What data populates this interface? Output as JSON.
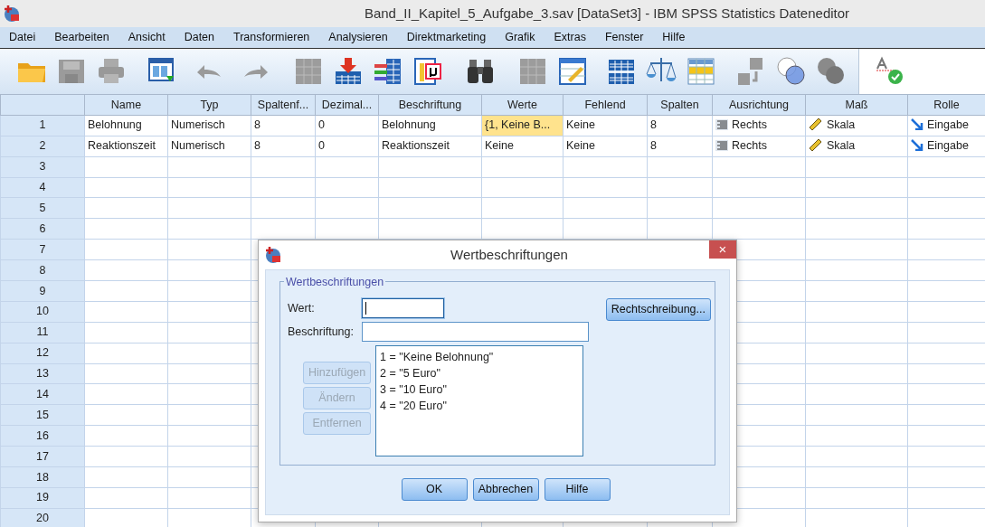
{
  "window": {
    "title": "Band_II_Kapitel_5_Aufgabe_3.sav [DataSet3] - IBM SPSS Statistics Dateneditor"
  },
  "menu": [
    "Datei",
    "Bearbeiten",
    "Ansicht",
    "Daten",
    "Transformieren",
    "Analysieren",
    "Direktmarketing",
    "Grafik",
    "Extras",
    "Fenster",
    "Hilfe"
  ],
  "table": {
    "columns": [
      "Name",
      "Typ",
      "Spaltenf...",
      "Dezimal...",
      "Beschriftung",
      "Werte",
      "Fehlend",
      "Spalten",
      "Ausrichtung",
      "Maß",
      "Rolle"
    ],
    "rows": [
      {
        "number": "1",
        "cells": [
          {
            "kind": "text",
            "text": "Belohnung",
            "selected": false
          },
          {
            "kind": "text",
            "text": "Numerisch",
            "selected": false
          },
          {
            "kind": "text",
            "text": "8",
            "selected": false
          },
          {
            "kind": "text",
            "text": "0",
            "selected": false
          },
          {
            "kind": "text",
            "text": "Belohnung",
            "selected": false
          },
          {
            "kind": "text",
            "text": "{1, Keine B...",
            "selected": true
          },
          {
            "kind": "text",
            "text": "Keine",
            "selected": false
          },
          {
            "kind": "text",
            "text": "8",
            "selected": false
          },
          {
            "kind": "align",
            "text": "Rechts",
            "selected": false
          },
          {
            "kind": "measure",
            "text": "Skala",
            "selected": false
          },
          {
            "kind": "role",
            "text": "Eingabe",
            "selected": false
          }
        ]
      },
      {
        "number": "2",
        "cells": [
          {
            "kind": "text",
            "text": "Reaktionszeit",
            "selected": false
          },
          {
            "kind": "text",
            "text": "Numerisch",
            "selected": false
          },
          {
            "kind": "text",
            "text": "8",
            "selected": false
          },
          {
            "kind": "text",
            "text": "0",
            "selected": false
          },
          {
            "kind": "text",
            "text": "Reaktionszeit",
            "selected": false
          },
          {
            "kind": "text",
            "text": "Keine",
            "selected": false
          },
          {
            "kind": "text",
            "text": "Keine",
            "selected": false
          },
          {
            "kind": "text",
            "text": "8",
            "selected": false
          },
          {
            "kind": "align",
            "text": "Rechts",
            "selected": false
          },
          {
            "kind": "measure",
            "text": "Skala",
            "selected": false
          },
          {
            "kind": "role",
            "text": "Eingabe",
            "selected": false
          }
        ]
      },
      {
        "number": "3"
      },
      {
        "number": "4"
      },
      {
        "number": "5"
      },
      {
        "number": "6"
      },
      {
        "number": "7"
      },
      {
        "number": "8"
      },
      {
        "number": "9"
      },
      {
        "number": "10"
      },
      {
        "number": "11"
      },
      {
        "number": "12"
      },
      {
        "number": "13"
      },
      {
        "number": "14"
      },
      {
        "number": "15"
      },
      {
        "number": "16"
      },
      {
        "number": "17"
      },
      {
        "number": "18"
      },
      {
        "number": "19"
      },
      {
        "number": "20"
      }
    ]
  },
  "dialog": {
    "title": "Wertbeschriftungen",
    "close": "×",
    "group": "Wertbeschriftungen",
    "fields": [
      {
        "label": "Wert:",
        "focused": true
      },
      {
        "label": "Beschriftung:",
        "focused": false
      }
    ],
    "spelling_button": "Rechtschreibung...",
    "side_buttons": [
      {
        "label": "Hinzufügen",
        "disabled": true
      },
      {
        "label": "Ändern",
        "disabled": true
      },
      {
        "label": "Entfernen",
        "disabled": true
      }
    ],
    "list": [
      "1 = \"Keine Belohnung\"",
      "2 = \"5 Euro\"",
      "3 = \"10 Euro\"",
      "4 = \"20 Euro\""
    ],
    "buttons": [
      "OK",
      "Abbrechen",
      "Hilfe"
    ]
  }
}
